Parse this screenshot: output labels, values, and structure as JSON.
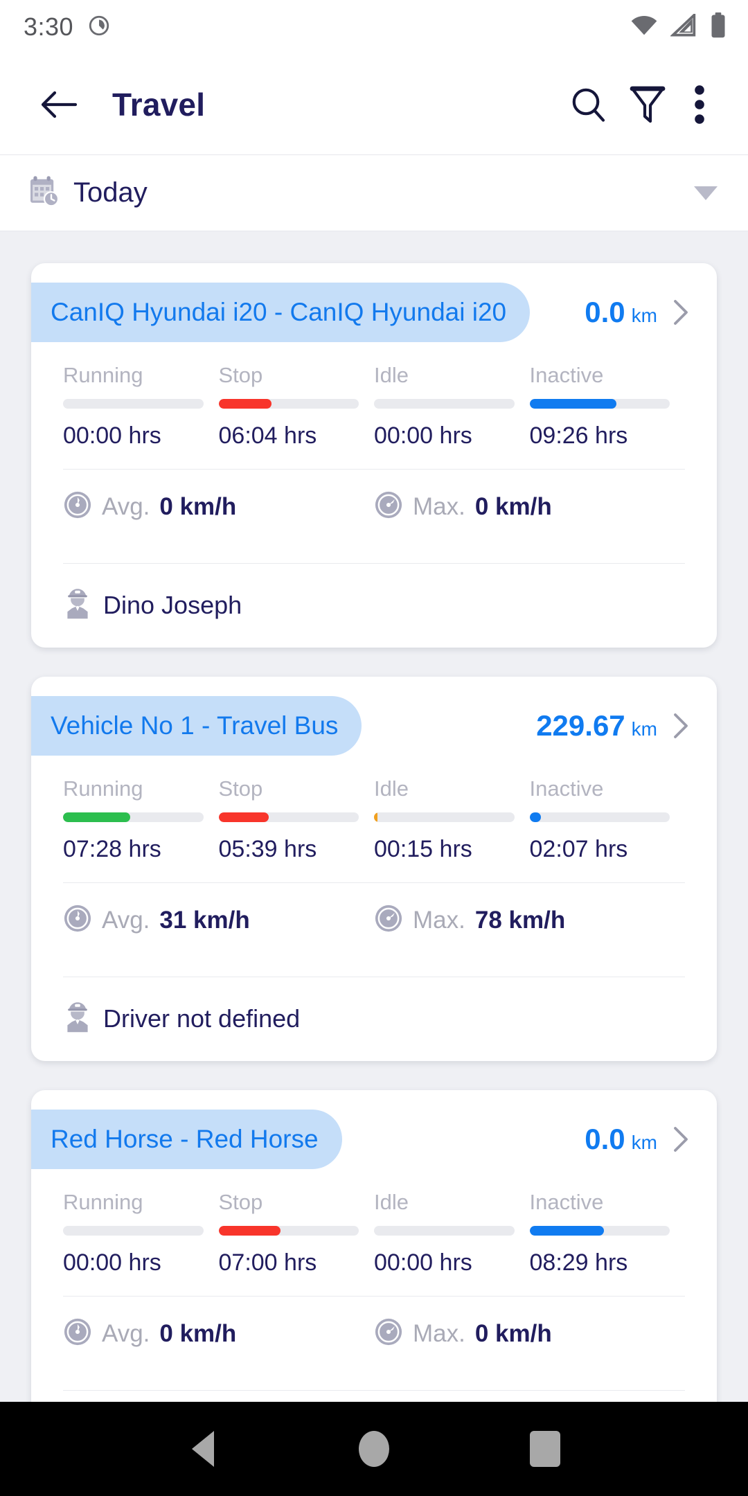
{
  "status_bar": {
    "time": "3:30",
    "icons": [
      "notification-circle-icon",
      "wifi-icon",
      "cellular-signal-icon",
      "battery-icon"
    ]
  },
  "toolbar": {
    "back_icon": "back-arrow-icon",
    "title": "Travel",
    "search_icon": "search-icon",
    "filter_icon": "filter-funnel-icon",
    "overflow_icon": "overflow-menu-icon"
  },
  "date_filter": {
    "icon": "calendar-clock-icon",
    "label": "Today",
    "caret": "chevron-down-icon"
  },
  "stat_labels": [
    "Running",
    "Stop",
    "Idle",
    "Inactive"
  ],
  "speed_labels": {
    "avg": "Avg.",
    "max": "Max."
  },
  "colors": {
    "running": "#2cbe4e",
    "stop": "#f8352b",
    "idle": "#f0a020",
    "inactive": "#107bf0",
    "track": "#e9eaee",
    "accent": "#107bf0",
    "pill_bg": "#c5def9",
    "pill_text": "#1279ed",
    "title": "#211d5e",
    "page_bg": "#eff0f4"
  },
  "cards": [
    {
      "vehicle": "CanIQ Hyundai i20 - CanIQ Hyundai i20",
      "distance": "0.0",
      "distance_unit": "km",
      "stats": [
        {
          "label": "Running",
          "value": "00:00 hrs",
          "pct": 0
        },
        {
          "label": "Stop",
          "value": "06:04 hrs",
          "pct": 38
        },
        {
          "label": "Idle",
          "value": "00:00 hrs",
          "pct": 0
        },
        {
          "label": "Inactive",
          "value": "09:26 hrs",
          "pct": 62
        }
      ],
      "avg_speed": "0 km/h",
      "max_speed": "0 km/h",
      "driver": "Dino Joseph"
    },
    {
      "vehicle": "Vehicle No 1 - Travel Bus",
      "distance": "229.67",
      "distance_unit": "km",
      "stats": [
        {
          "label": "Running",
          "value": "07:28 hrs",
          "pct": 48
        },
        {
          "label": "Stop",
          "value": "05:39 hrs",
          "pct": 36
        },
        {
          "label": "Idle",
          "value": "00:15 hrs",
          "pct": 2
        },
        {
          "label": "Inactive",
          "value": "02:07 hrs",
          "pct": 8
        }
      ],
      "avg_speed": "31 km/h",
      "max_speed": "78 km/h",
      "driver": "Driver not defined"
    },
    {
      "vehicle": "Red Horse - Red Horse",
      "distance": "0.0",
      "distance_unit": "km",
      "stats": [
        {
          "label": "Running",
          "value": "00:00 hrs",
          "pct": 0
        },
        {
          "label": "Stop",
          "value": "07:00 hrs",
          "pct": 44
        },
        {
          "label": "Idle",
          "value": "00:00 hrs",
          "pct": 0
        },
        {
          "label": "Inactive",
          "value": "08:29 hrs",
          "pct": 53
        }
      ],
      "avg_speed": "0 km/h",
      "max_speed": "0 km/h",
      "driver": ""
    }
  ],
  "nav_bar": {
    "back": "nav-back-icon",
    "home": "nav-home-icon",
    "recents": "nav-recents-icon"
  }
}
